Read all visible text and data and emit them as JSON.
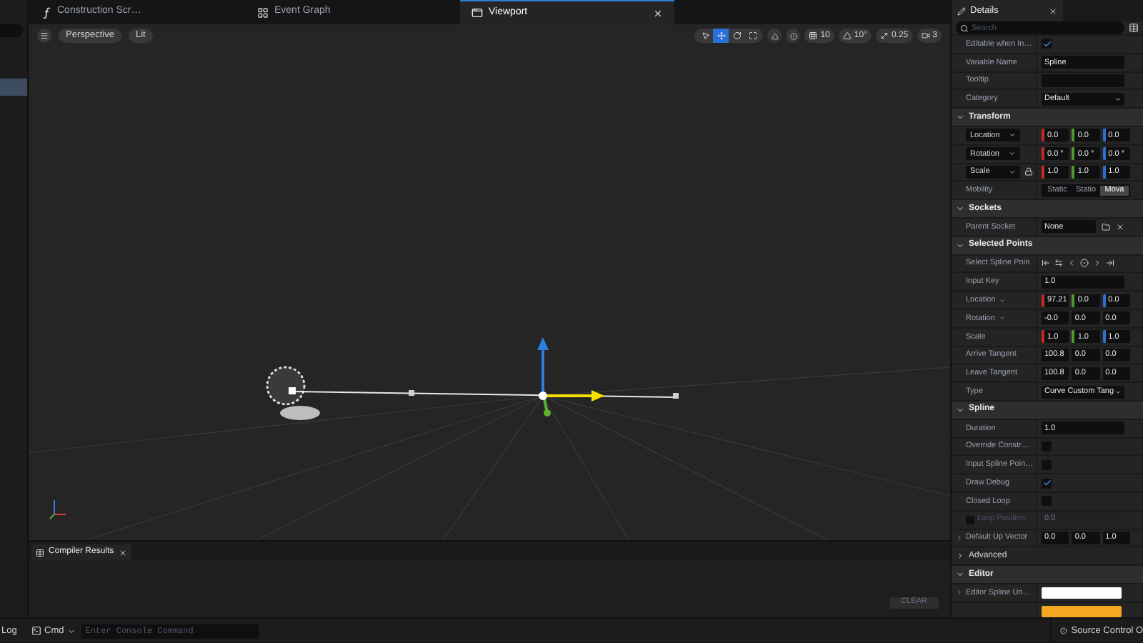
{
  "tabs": [
    {
      "label": "Construction Scr…",
      "kind": "function",
      "selected": false,
      "closable": false
    },
    {
      "label": "Event Graph",
      "kind": "graph",
      "selected": false,
      "closable": false
    },
    {
      "label": "Viewport",
      "kind": "viewport",
      "selected": true,
      "closable": true
    }
  ],
  "left_panel": {
    "rows": [
      {
        "selected": true
      }
    ]
  },
  "viewport": {
    "view_buttons": [
      "Perspective",
      "Lit"
    ],
    "tools": [
      {
        "kind": "select",
        "selected": false
      },
      {
        "kind": "translate",
        "selected": true
      },
      {
        "kind": "rotate",
        "selected": false
      },
      {
        "kind": "scale",
        "selected": false
      }
    ],
    "snaps": [
      {
        "kind": "grid",
        "value": "10"
      },
      {
        "kind": "angle",
        "value": "10°"
      },
      {
        "kind": "scale",
        "value": "0.25"
      },
      {
        "kind": "camera",
        "value": "3"
      }
    ]
  },
  "compiler": {
    "tab": "Compiler Results",
    "clear": "CLEAR"
  },
  "console": {
    "log": "Log",
    "cmd": "Cmd",
    "placeholder": "Enter Console Command"
  },
  "status": {
    "source_control": "Source Control O"
  },
  "details": {
    "title": "Details",
    "search_placeholder": "Search",
    "rows": [
      {
        "kind": "checkbox",
        "label": "Editable when In…",
        "checked": true
      },
      {
        "kind": "text",
        "label": "Variable Name",
        "value": "Spline",
        "disabled": false
      },
      {
        "kind": "text",
        "label": "Tooltip",
        "disabled": false
      },
      {
        "kind": "dropdown",
        "label": "Category",
        "value": "Default"
      },
      {
        "kind": "section",
        "label": "Transform",
        "expanded": true
      },
      {
        "kind": "vector",
        "label": "Location",
        "label_dropdown": true,
        "label_boxed": true,
        "colored": true,
        "values": [
          "0.0",
          "0.0",
          "0.0"
        ]
      },
      {
        "kind": "vector",
        "label": "Rotation",
        "label_dropdown": true,
        "label_boxed": true,
        "colored": true,
        "values": [
          "0.0 °",
          "0.0 °",
          "0.0 °"
        ]
      },
      {
        "kind": "vector",
        "label": "Scale",
        "label_dropdown": true,
        "label_boxed": true,
        "colored": true,
        "lock": true,
        "values": [
          "1.0",
          "1.0",
          "1.0"
        ]
      },
      {
        "kind": "segmented",
        "label": "Mobility",
        "options": [
          {
            "label": "Static",
            "selected": false
          },
          {
            "label": "Statio",
            "selected": false
          },
          {
            "label": "Mova",
            "selected": true
          }
        ]
      },
      {
        "kind": "section",
        "label": "Sockets",
        "expanded": true
      },
      {
        "kind": "socket",
        "label": "Parent Socket",
        "value": "None"
      },
      {
        "kind": "section",
        "label": "Selected Points",
        "expanded": true
      },
      {
        "kind": "icons",
        "label": "Select Spline Poin"
      },
      {
        "kind": "text",
        "label": "Input Key",
        "value": "1.0",
        "disabled": false
      },
      {
        "kind": "vector",
        "label": "Location",
        "label_dropdown": true,
        "label_boxed": false,
        "colored": true,
        "values": [
          "97.21",
          "0.0",
          "0.0"
        ]
      },
      {
        "kind": "vector",
        "label": "Rotation",
        "label_dropdown": true,
        "label_boxed": false,
        "colored": false,
        "values": [
          "-0.0",
          "0.0",
          "0.0"
        ]
      },
      {
        "kind": "vector",
        "label": "Scale",
        "label_dropdown": false,
        "label_boxed": false,
        "colored": true,
        "values": [
          "1.0",
          "1.0",
          "1.0"
        ]
      },
      {
        "kind": "vector",
        "label": "Arrive Tangent",
        "label_dropdown": false,
        "label_boxed": false,
        "colored": false,
        "values": [
          "100.8",
          "0.0",
          "0.0"
        ]
      },
      {
        "kind": "vector",
        "label": "Leave Tangent",
        "label_dropdown": false,
        "label_boxed": false,
        "colored": false,
        "values": [
          "100.8",
          "0.0",
          "0.0"
        ]
      },
      {
        "kind": "dropdown",
        "label": "Type",
        "value": "Curve Custom Tang"
      },
      {
        "kind": "section",
        "label": "Spline",
        "expanded": true
      },
      {
        "kind": "text",
        "label": "Duration",
        "value": "1.0",
        "disabled": false
      },
      {
        "kind": "checkbox",
        "label": "Override Constr…",
        "checked": false
      },
      {
        "kind": "checkbox",
        "label": "Input Spline Poin…",
        "checked": false
      },
      {
        "kind": "checkbox",
        "label": "Draw Debug",
        "checked": true
      },
      {
        "kind": "checkbox",
        "label": "Closed Loop",
        "checked": false
      },
      {
        "kind": "text",
        "label": "Loop Position",
        "value": "0.0",
        "disabled": true,
        "edit_condition": false
      },
      {
        "kind": "vector",
        "label": "Default Up Vector",
        "label_dropdown": false,
        "label_boxed": false,
        "colored": false,
        "expandable": true,
        "values": [
          "0.0",
          "0.0",
          "1.0"
        ]
      },
      {
        "kind": "group",
        "label": "Advanced",
        "expanded": false
      },
      {
        "kind": "section",
        "label": "Editor",
        "expanded": true
      },
      {
        "kind": "color",
        "label": "Editor Spline Un…",
        "color": "#ffffff",
        "expandable": true
      },
      {
        "kind": "color",
        "color": "#f5a623",
        "expandable": false
      }
    ]
  }
}
